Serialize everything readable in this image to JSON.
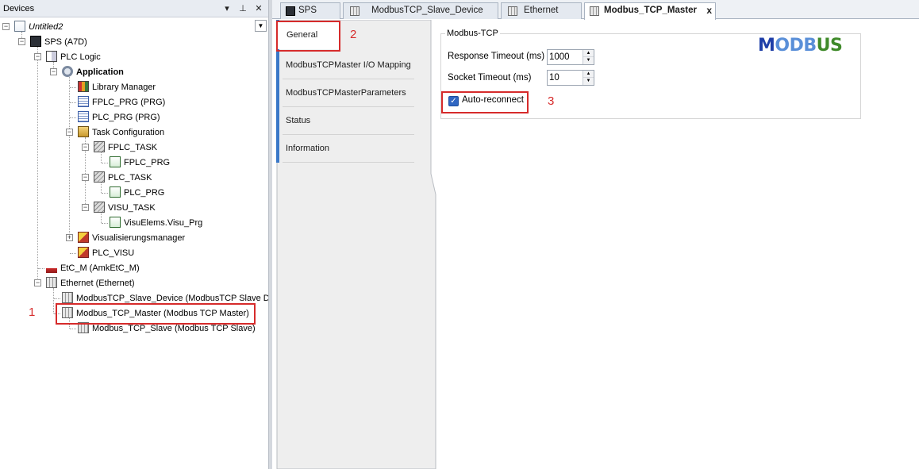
{
  "devices": {
    "title": "Devices",
    "header_icons": [
      "chevron-down-icon",
      "pin-icon",
      "close-icon"
    ],
    "tree": [
      {
        "label": "Untitled2",
        "icon": "project-icon",
        "italic": true
      },
      {
        "label": "SPS (A7D)",
        "icon": "plc-icon"
      },
      {
        "label": "PLC Logic",
        "icon": "plc-logic-icon"
      },
      {
        "label": "Application",
        "icon": "application-gear-icon",
        "bold": true
      },
      {
        "label": "Library Manager",
        "icon": "library-manager-icon"
      },
      {
        "label": "FPLC_PRG (PRG)",
        "icon": "program-icon"
      },
      {
        "label": "PLC_PRG (PRG)",
        "icon": "program-icon"
      },
      {
        "label": "Task Configuration",
        "icon": "task-configuration-icon"
      },
      {
        "label": "FPLC_TASK",
        "icon": "task-icon"
      },
      {
        "label": "FPLC_PRG",
        "icon": "pou-icon"
      },
      {
        "label": "PLC_TASK",
        "icon": "task-icon"
      },
      {
        "label": "PLC_PRG",
        "icon": "pou-icon"
      },
      {
        "label": "VISU_TASK",
        "icon": "task-icon"
      },
      {
        "label": "VisuElems.Visu_Prg",
        "icon": "pou-icon"
      },
      {
        "label": "Visualisierungsmanager",
        "icon": "visu-manager-icon"
      },
      {
        "label": "PLC_VISU",
        "icon": "visu-icon"
      },
      {
        "label": "EtC_M (AmkEtC_M)",
        "icon": "etc-bus-icon"
      },
      {
        "label": "Ethernet (Ethernet)",
        "icon": "ethernet-icon"
      },
      {
        "label": "ModbusTCP_Slave_Device (ModbusTCP Slave Dev",
        "icon": "modbus-device-icon"
      },
      {
        "label": "Modbus_TCP_Master (Modbus TCP Master)",
        "icon": "modbus-device-icon"
      },
      {
        "label": "Modbus_TCP_Slave (Modbus TCP Slave)",
        "icon": "modbus-device-icon"
      }
    ]
  },
  "annotations": {
    "one": "1",
    "two": "2",
    "three": "3",
    "color": "#d62b2b"
  },
  "editor_tabs": [
    {
      "label": "SPS",
      "icon": "plc-icon"
    },
    {
      "label": "ModbusTCP_Slave_Device",
      "icon": "modbus-device-icon"
    },
    {
      "label": "Ethernet",
      "icon": "ethernet-icon"
    },
    {
      "label": "Modbus_TCP_Master",
      "icon": "modbus-device-icon",
      "active": true,
      "close": "x"
    }
  ],
  "side_tabs": [
    "General",
    "ModbusTCPMaster I/O Mapping",
    "ModbusTCPMasterParameters",
    "Status",
    "Information"
  ],
  "general": {
    "group_title": "Modbus-TCP",
    "response_timeout_label": "Response  Timeout (ms)",
    "response_timeout_value": "1000",
    "socket_timeout_label": "Socket Timeout (ms)",
    "socket_timeout_value": "10",
    "autoreconnect_label": "Auto-reconnect",
    "autoreconnect_checked": true
  },
  "logo": {
    "parts": [
      "M",
      "ODB",
      "US"
    ],
    "colors": [
      "#1f3fa8",
      "#5a8fd8",
      "#3f8a2a"
    ]
  }
}
